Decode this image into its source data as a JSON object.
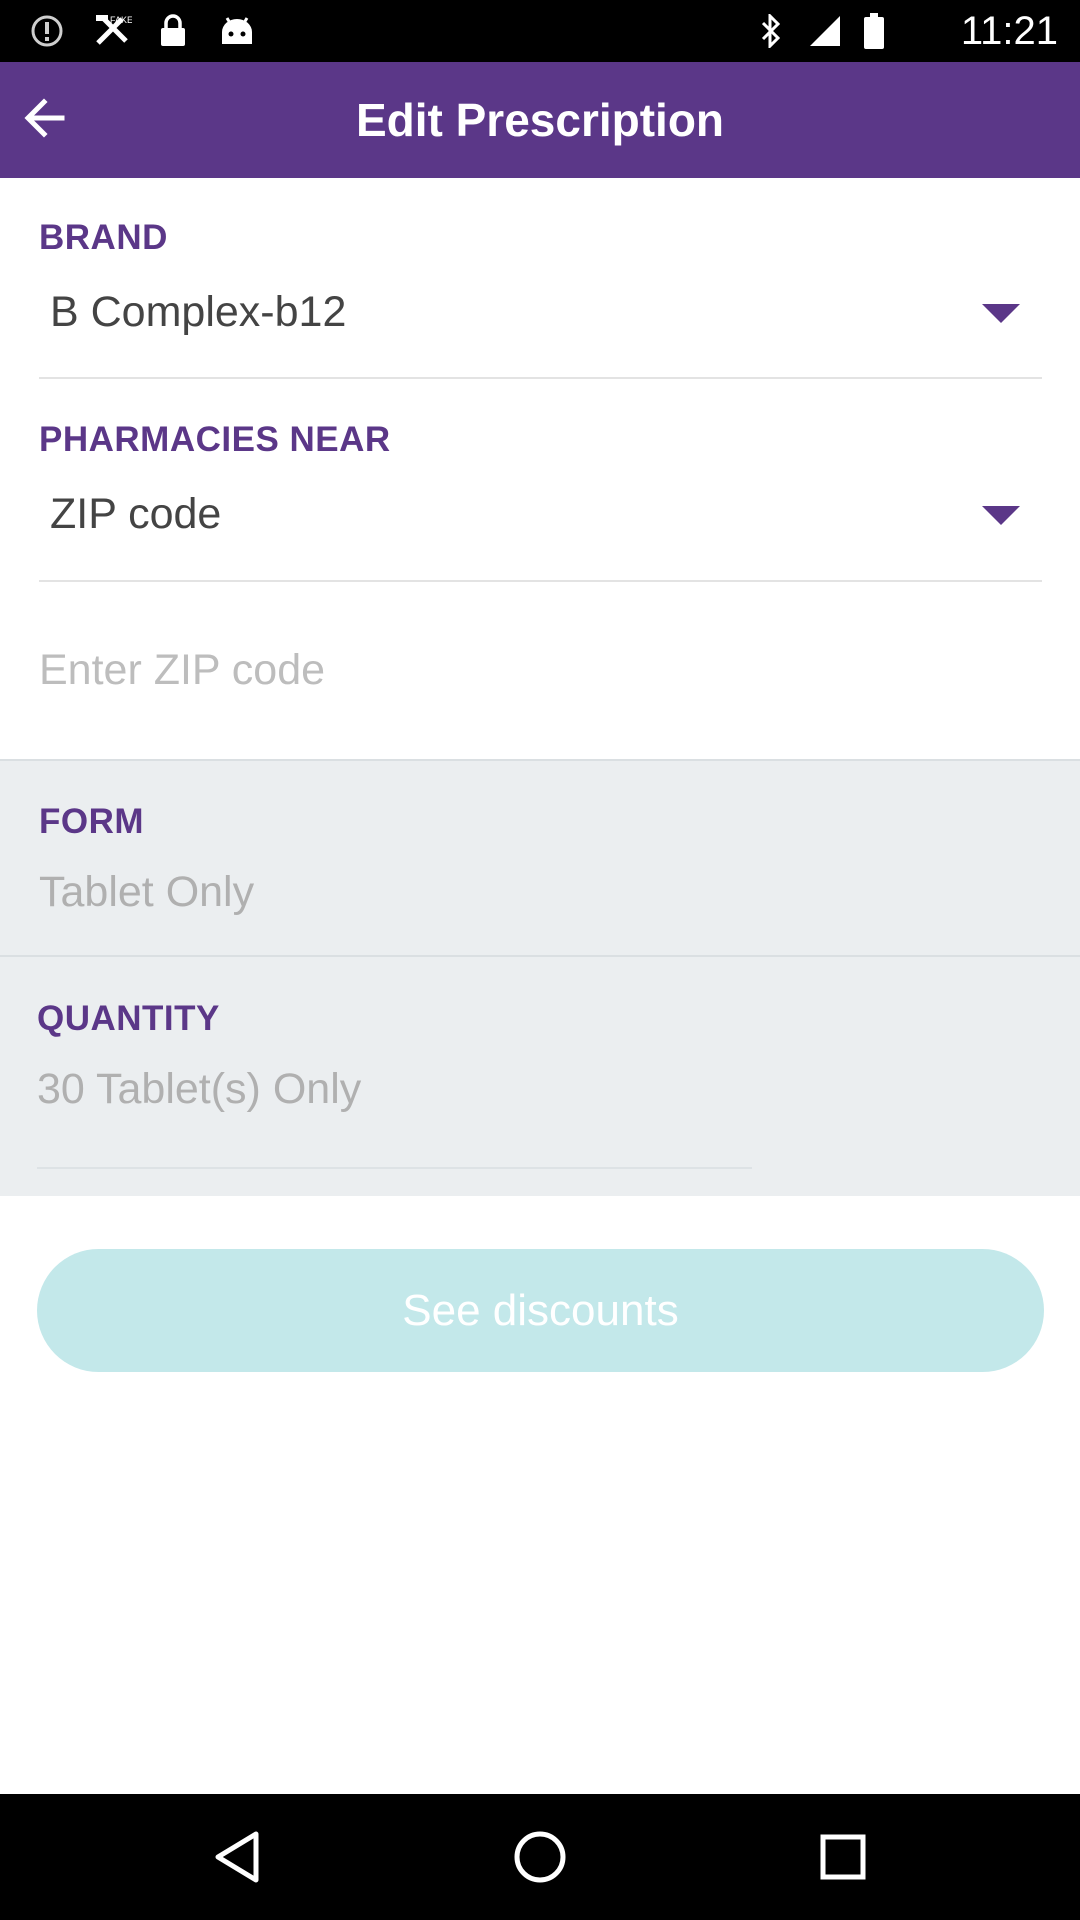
{
  "status_bar": {
    "time": "11:21",
    "left_icons": [
      "alert-circle-icon",
      "fake-gps-icon",
      "lock-icon",
      "android-icon"
    ],
    "right_icons": [
      "bluetooth-icon",
      "signal-icon",
      "battery-icon"
    ]
  },
  "app_bar": {
    "title": "Edit Prescription",
    "back_icon": "arrow-back-icon",
    "color": "#5b3788"
  },
  "brand": {
    "label": "BRAND",
    "value": "B Complex-b12"
  },
  "pharmacies": {
    "label": "PHARMACIES NEAR",
    "value": "ZIP code"
  },
  "zip_input": {
    "placeholder": "Enter ZIP code",
    "value": ""
  },
  "form": {
    "label": "FORM",
    "value": "Tablet Only"
  },
  "quantity": {
    "label": "QUANTITY",
    "value": "30 Tablet(s) Only"
  },
  "discount_button": {
    "label": "See discounts",
    "color": "#c3e8ea"
  },
  "nav_bar": {
    "icons": [
      "back-triangle-icon",
      "home-circle-icon",
      "recents-square-icon"
    ]
  }
}
